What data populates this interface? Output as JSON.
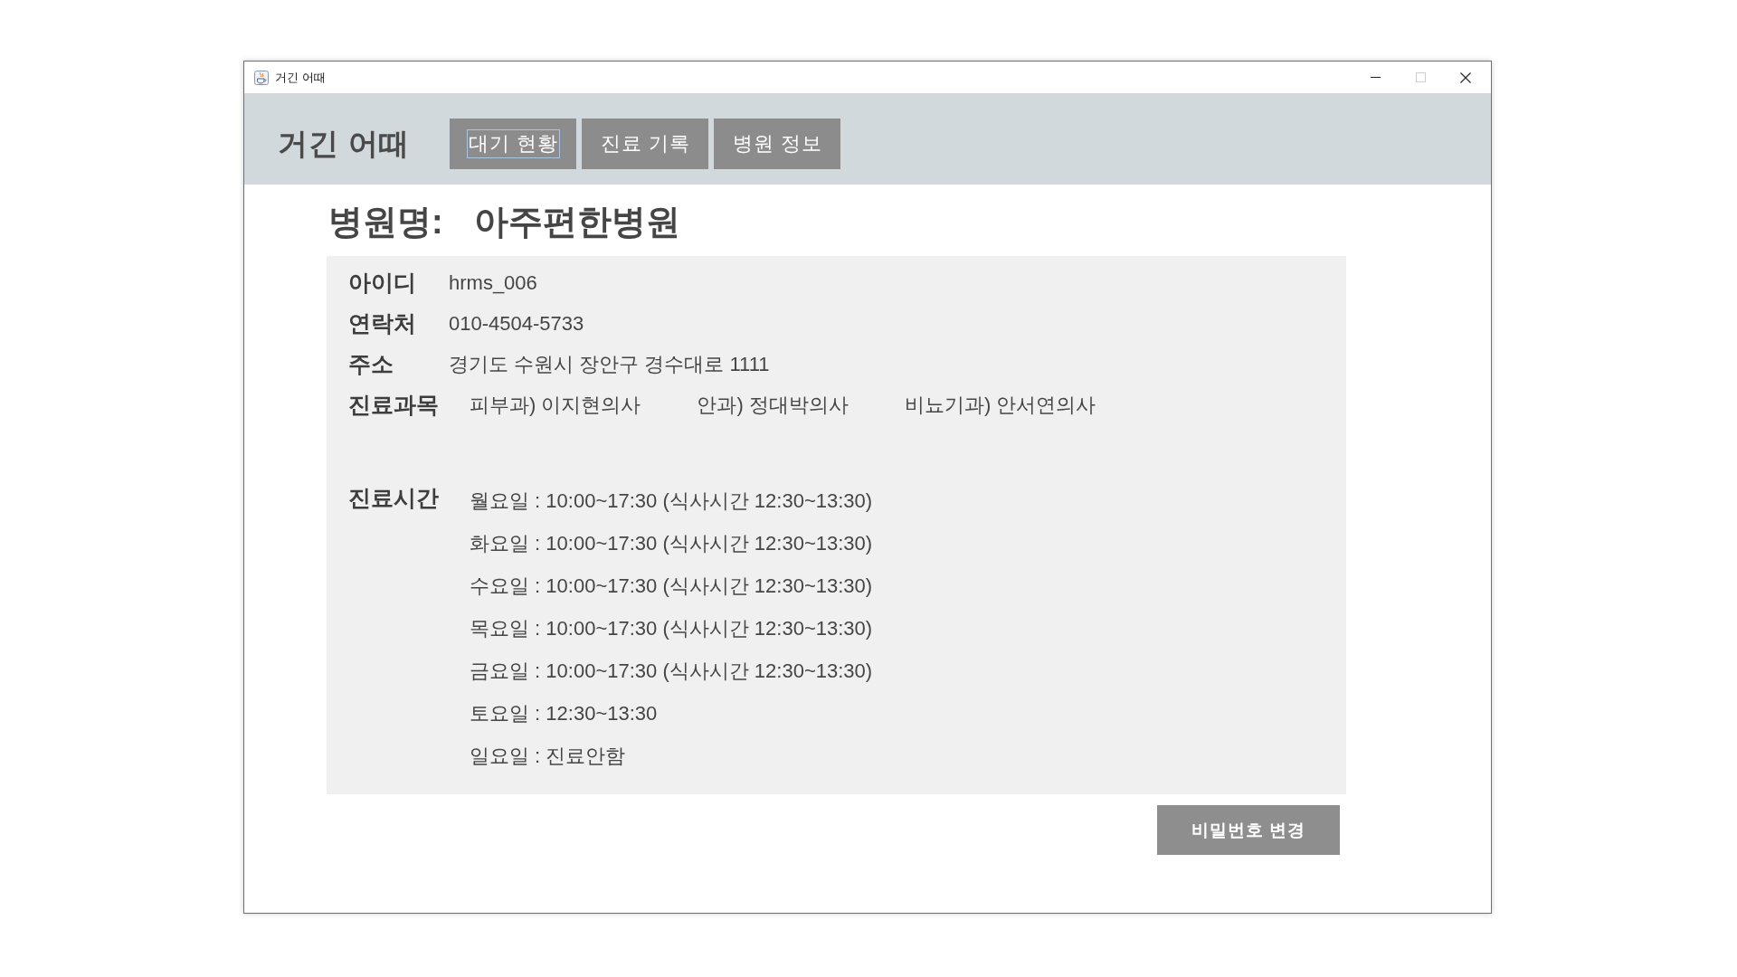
{
  "window": {
    "title": "거긴 어때",
    "maximize_disabled": true
  },
  "header": {
    "logo": "거긴 어때",
    "tabs": [
      {
        "label": "대기 현황",
        "selected": true
      },
      {
        "label": "진료 기록",
        "selected": false
      },
      {
        "label": "병원 정보",
        "selected": false
      }
    ]
  },
  "hospital": {
    "label": "병원명:",
    "name": "아주편한병원"
  },
  "info": [
    {
      "kind": "text",
      "label": "아이디",
      "value": "hrms_006"
    },
    {
      "kind": "text",
      "label": "연락처",
      "value": "010-4504-5733"
    },
    {
      "kind": "text",
      "label": "주소",
      "value": "경기도 수원시 장안구 경수대로 1111"
    },
    {
      "kind": "list",
      "label": "진료과목",
      "items": [
        "피부과) 이지현의사",
        "안과) 정대박의사",
        "비뇨기과) 안서연의사"
      ]
    }
  ],
  "hours": {
    "label": "진료시간",
    "lines": [
      "월요일 : 10:00~17:30 (식사시간 12:30~13:30)",
      "화요일 : 10:00~17:30 (식사시간 12:30~13:30)",
      "수요일 : 10:00~17:30 (식사시간 12:30~13:30)",
      "목요일 : 10:00~17:30 (식사시간 12:30~13:30)",
      "금요일 : 10:00~17:30 (식사시간 12:30~13:30)",
      "토요일 : 12:30~13:30",
      "일요일 : 진료안함"
    ]
  },
  "button": "비밀번호 변경"
}
